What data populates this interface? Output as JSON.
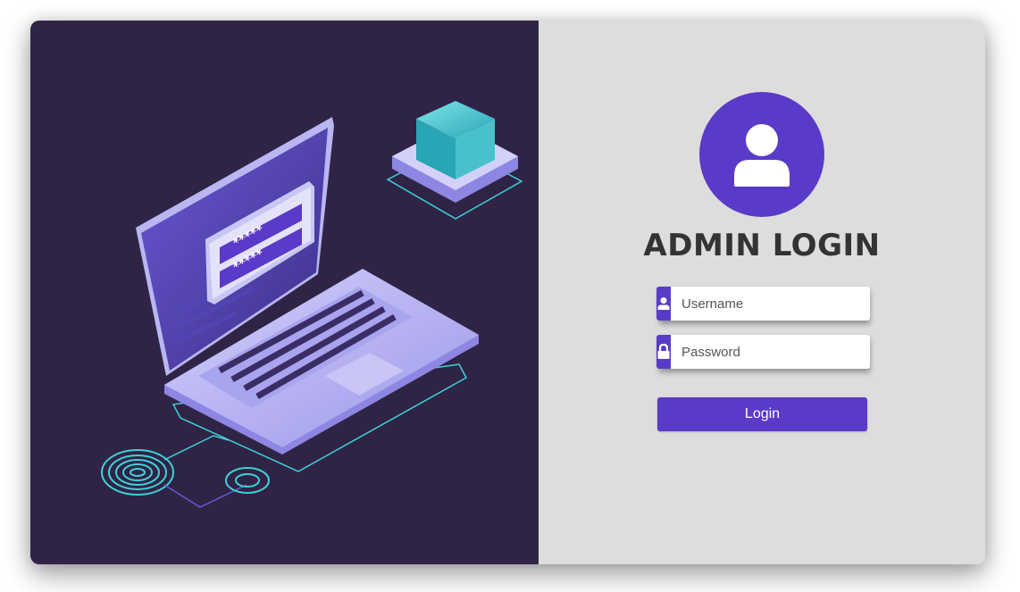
{
  "login": {
    "title": "ADMIN LOGIN",
    "username_placeholder": "Username",
    "username_value": "",
    "password_placeholder": "Password",
    "password_value": "",
    "submit_label": "Login"
  },
  "illustration": {
    "password_mask_1": "*****",
    "password_mask_2": "*****"
  },
  "icons": {
    "avatar": "user-avatar-icon",
    "username": "user-icon",
    "password": "lock-icon"
  },
  "colors": {
    "accent": "#5a3ac8",
    "left_panel_bg": "#2f2445",
    "right_panel_bg": "#dddddd",
    "title_text": "#333333",
    "teal": "#3fd0d8",
    "lavender": "#b9b6f2"
  }
}
